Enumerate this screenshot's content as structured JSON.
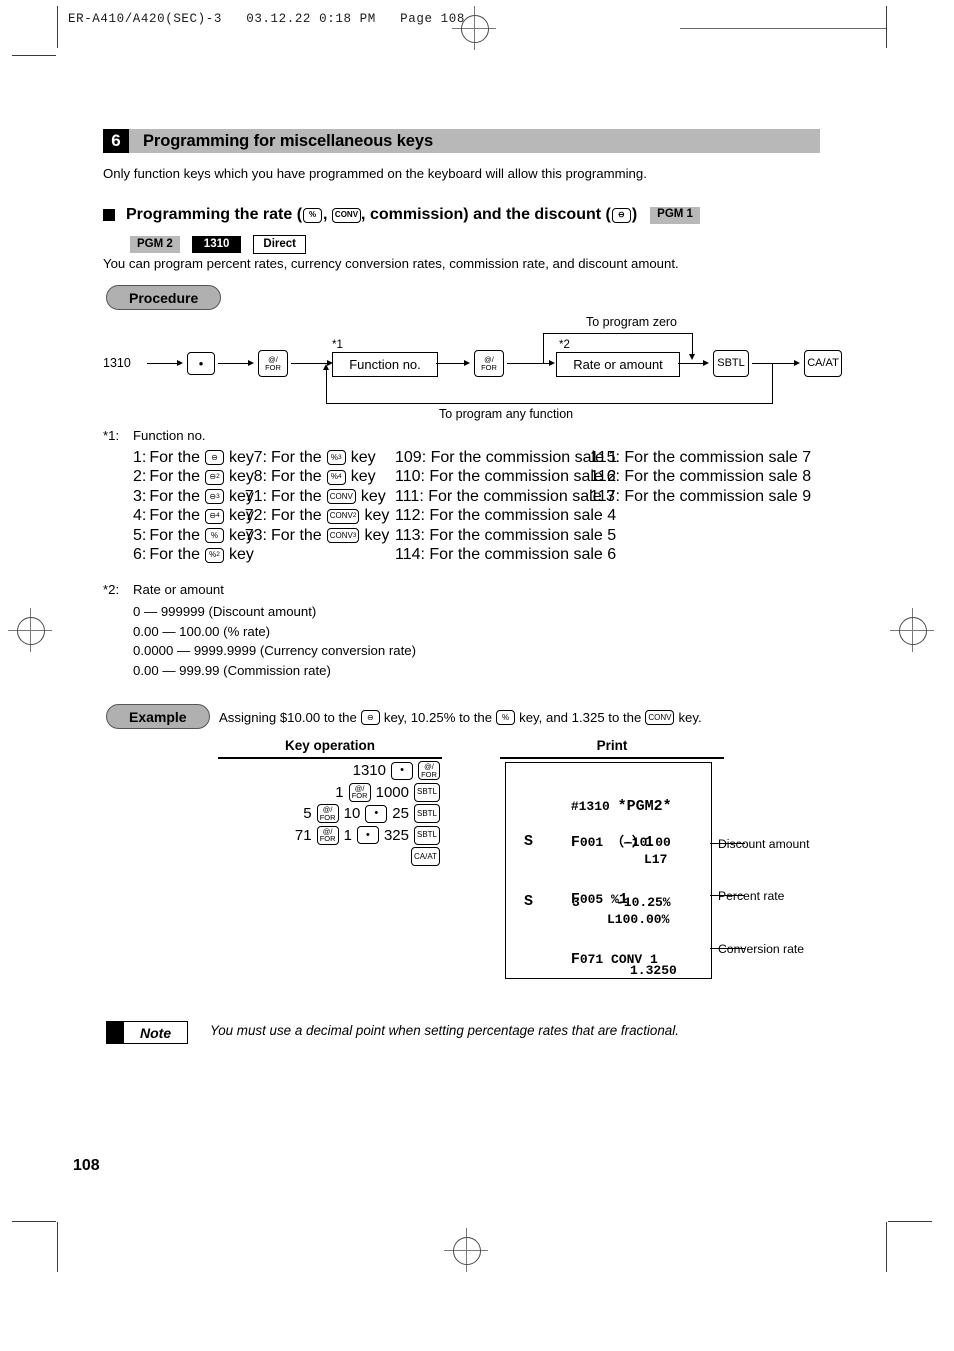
{
  "print_header": "ER-A410/A420(SEC)-3   03.12.22 0:18 PM   Page 108",
  "section": {
    "number": "6",
    "title": "Programming for miscellaneous keys",
    "intro": "Only function keys which you have programmed on the keyboard will allow this programming."
  },
  "subsection": {
    "prefix": "Programming the rate (",
    "mid": ", commission) and the discount (",
    "suffix": ")",
    "key1": "%",
    "key2": "CONV",
    "key3": "⊖",
    "badges": [
      "PGM 1",
      "PGM 2",
      "1310",
      "Direct"
    ],
    "description": "You can program percent rates, currency conversion rates, commission rate, and discount amount."
  },
  "procedure": {
    "label": "Procedure",
    "start": "1310",
    "key_dot": "•",
    "key_for_top": "@/",
    "key_for_bottom": "FOR",
    "box_function": "Function no.",
    "box_rate": "Rate or amount",
    "key_sbtl": "SBTL",
    "key_caat": "CA/AT",
    "mark1": "*1",
    "mark2": "*2",
    "label_zero": "To program zero",
    "label_any": "To program any function"
  },
  "footnote1": {
    "marker": "*1:",
    "title": "Function no.",
    "col1": [
      {
        "num": "1:",
        "text": "For the",
        "key": "⊖",
        "sub": "",
        "tail": "key"
      },
      {
        "num": "2:",
        "text": "For the",
        "key": "⊖",
        "sub": "2",
        "tail": "key"
      },
      {
        "num": "3:",
        "text": "For the",
        "key": "⊖",
        "sub": "3",
        "tail": "key"
      },
      {
        "num": "4:",
        "text": "For the",
        "key": "⊖",
        "sub": "4",
        "tail": "key"
      },
      {
        "num": "5:",
        "text": "For the",
        "key": "%",
        "sub": "",
        "tail": "key"
      },
      {
        "num": "6:",
        "text": "For the",
        "key": "%",
        "sub": "2",
        "tail": "key"
      }
    ],
    "col2": [
      {
        "num": "7:",
        "text": "For the",
        "key": "%",
        "sub": "3",
        "tail": "key"
      },
      {
        "num": "8:",
        "text": "For the",
        "key": "%",
        "sub": "4",
        "tail": "key"
      },
      {
        "num": "71:",
        "text": "For the",
        "key": "CONV",
        "sub": "",
        "tail": "key"
      },
      {
        "num": "72:",
        "text": "For the",
        "key": "CONV",
        "sub": "2",
        "tail": "key"
      },
      {
        "num": "73:",
        "text": "For the",
        "key": "CONV",
        "sub": "3",
        "tail": "key"
      }
    ],
    "col3": [
      "109: For the commission sale 1",
      "110: For the commission sale 2",
      "111: For the commission sale 3",
      "112: For the commission sale 4",
      "113: For the commission sale 5",
      "114: For the commission sale 6"
    ],
    "col4": [
      "115: For the commission sale 7",
      "116: For the commission sale 8",
      "117: For the commission sale 9"
    ]
  },
  "footnote2": {
    "marker": "*2:",
    "title": "Rate or amount",
    "lines": [
      "0 — 999999 (Discount amount)",
      "0.00 — 100.00 (% rate)",
      "0.0000 — 9999.9999 (Currency conversion rate)",
      "0.00 — 999.99 (Commission rate)"
    ]
  },
  "example": {
    "label": "Example",
    "t1": "Assigning $10.00 to the",
    "t2": "key, 10.25% to the",
    "t3": "key, and 1.325 to the",
    "t4": "key.",
    "k1": "⊖",
    "k2": "%",
    "k3": "CONV",
    "col_keyop": "Key operation",
    "col_print": "Print",
    "rows": [
      {
        "cells": [
          "1310",
          "KEY:DOT",
          "KEY:FOR"
        ]
      },
      {
        "cells": [
          "1",
          "KEY:FOR",
          "1000",
          "KEY:SBTL"
        ]
      },
      {
        "cells": [
          "5",
          "KEY:FOR",
          "10",
          "KEY:DOT",
          "25",
          "KEY:SBTL"
        ]
      },
      {
        "cells": [
          "71",
          "KEY:FOR",
          "1",
          "KEY:DOT",
          "325",
          "KEY:SBTL"
        ]
      },
      {
        "cells": [
          "KEY:CAAT"
        ]
      }
    ]
  },
  "receipt": {
    "line1": "#1310",
    "line1b": "*PGM2*",
    "line2a": "F",
    "line2b": "001 （—）",
    "line2c": "1",
    "line3a": "S",
    "line3b": "-10.00",
    "line4": "L17",
    "line5a": "F",
    "line5b": "005 %",
    "line5c": "1",
    "line6a": "S",
    "line6b": "3",
    "line6c": "-10.25%",
    "line7": "L100.00%",
    "line8a": "F",
    "line8b": "071 CONV 1",
    "line9": "1.3250"
  },
  "callouts": [
    "Discount amount",
    "Percent rate",
    "Conversion rate"
  ],
  "note": {
    "label": "Note",
    "text": "You must use a decimal point when setting percentage rates that are fractional."
  },
  "page_number": "108"
}
